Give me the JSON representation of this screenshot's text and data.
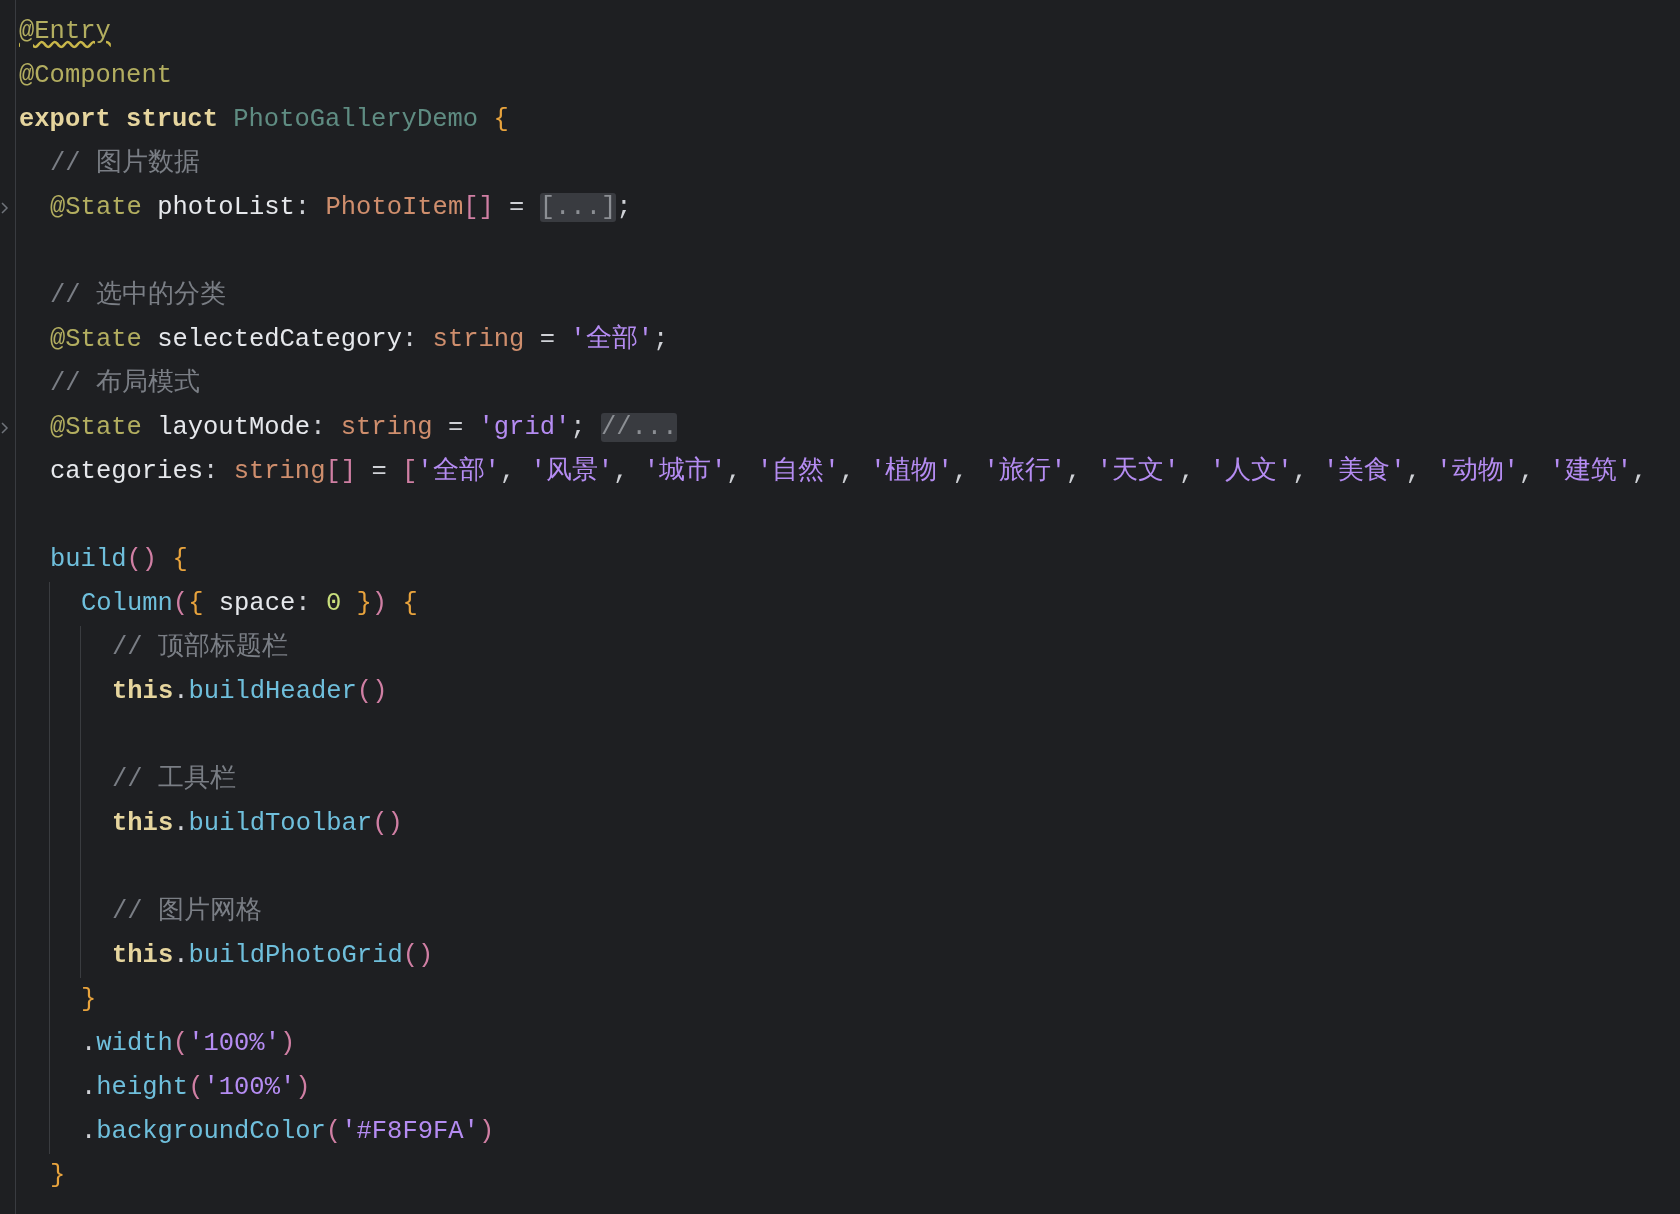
{
  "editor": {
    "lines": [
      {
        "folded": false,
        "tokens": [
          {
            "kind": "annotation-warn",
            "text": "@Entry"
          }
        ]
      },
      {
        "folded": false,
        "tokens": [
          {
            "kind": "annotation",
            "text": "@Component"
          }
        ]
      },
      {
        "folded": false,
        "tokens": [
          {
            "kind": "keyword",
            "text": "export struct "
          },
          {
            "kind": "class",
            "text": "PhotoGalleryDemo "
          },
          {
            "kind": "brace",
            "text": "{"
          }
        ],
        "children": [
          {
            "folded": false,
            "tokens": [
              {
                "kind": "comment",
                "text": "// 图片数据"
              }
            ]
          },
          {
            "folded": true,
            "tokens": [
              {
                "kind": "annotation",
                "text": "@State "
              },
              {
                "kind": "field",
                "text": "photoList"
              },
              {
                "kind": "plain",
                "text": ": "
              },
              {
                "kind": "type",
                "text": "PhotoItem"
              },
              {
                "kind": "paren",
                "text": "[]"
              },
              {
                "kind": "plain",
                "text": " = "
              },
              {
                "kind": "folded",
                "text": "[...]"
              },
              {
                "kind": "plain",
                "text": ";"
              }
            ]
          },
          {
            "folded": false
          },
          {
            "folded": false,
            "tokens": [
              {
                "kind": "comment",
                "text": "// 选中的分类"
              }
            ]
          },
          {
            "folded": false,
            "tokens": [
              {
                "kind": "annotation",
                "text": "@State "
              },
              {
                "kind": "field",
                "text": "selectedCategory"
              },
              {
                "kind": "plain",
                "text": ": "
              },
              {
                "kind": "type",
                "text": "string"
              },
              {
                "kind": "plain",
                "text": " = "
              },
              {
                "kind": "string",
                "text": "'全部'"
              },
              {
                "kind": "plain",
                "text": ";"
              }
            ]
          },
          {
            "folded": false,
            "tokens": [
              {
                "kind": "comment",
                "text": "// 布局模式"
              }
            ]
          },
          {
            "folded": true,
            "tokens": [
              {
                "kind": "annotation",
                "text": "@State "
              },
              {
                "kind": "field",
                "text": "layoutMode"
              },
              {
                "kind": "plain",
                "text": ": "
              },
              {
                "kind": "type",
                "text": "string"
              },
              {
                "kind": "plain",
                "text": " = "
              },
              {
                "kind": "string",
                "text": "'grid'"
              },
              {
                "kind": "plain",
                "text": "; "
              },
              {
                "kind": "folded",
                "text": "//..."
              }
            ]
          },
          {
            "folded": false,
            "tokens": [
              {
                "kind": "field",
                "text": "categories"
              },
              {
                "kind": "plain",
                "text": ": "
              },
              {
                "kind": "type",
                "text": "string"
              },
              {
                "kind": "paren",
                "text": "[]"
              },
              {
                "kind": "plain",
                "text": " = "
              },
              {
                "kind": "paren",
                "text": "["
              },
              {
                "kind": "string",
                "text": "'全部'"
              },
              {
                "kind": "plain",
                "text": ", "
              },
              {
                "kind": "string",
                "text": "'风景'"
              },
              {
                "kind": "plain",
                "text": ", "
              },
              {
                "kind": "string",
                "text": "'城市'"
              },
              {
                "kind": "plain",
                "text": ", "
              },
              {
                "kind": "string",
                "text": "'自然'"
              },
              {
                "kind": "plain",
                "text": ", "
              },
              {
                "kind": "string",
                "text": "'植物'"
              },
              {
                "kind": "plain",
                "text": ", "
              },
              {
                "kind": "string",
                "text": "'旅行'"
              },
              {
                "kind": "plain",
                "text": ", "
              },
              {
                "kind": "string",
                "text": "'天文'"
              },
              {
                "kind": "plain",
                "text": ", "
              },
              {
                "kind": "string",
                "text": "'人文'"
              },
              {
                "kind": "plain",
                "text": ", "
              },
              {
                "kind": "string",
                "text": "'美食'"
              },
              {
                "kind": "plain",
                "text": ", "
              },
              {
                "kind": "string",
                "text": "'动物'"
              },
              {
                "kind": "plain",
                "text": ", "
              },
              {
                "kind": "string",
                "text": "'建筑'"
              },
              {
                "kind": "plain",
                "text": ","
              }
            ]
          },
          {
            "folded": false
          },
          {
            "folded": false,
            "tokens": [
              {
                "kind": "function",
                "text": "build"
              },
              {
                "kind": "paren",
                "text": "()"
              },
              {
                "kind": "brace",
                "text": " {"
              }
            ],
            "children": [
              {
                "folded": false,
                "tokens": [
                  {
                    "kind": "function",
                    "text": "Column"
                  },
                  {
                    "kind": "paren",
                    "text": "("
                  },
                  {
                    "kind": "brace",
                    "text": "{"
                  },
                  {
                    "kind": "field",
                    "text": " space"
                  },
                  {
                    "kind": "plain",
                    "text": ": "
                  },
                  {
                    "kind": "number",
                    "text": "0"
                  },
                  {
                    "kind": "brace",
                    "text": " }"
                  },
                  {
                    "kind": "paren",
                    "text": ")"
                  },
                  {
                    "kind": "brace",
                    "text": " {"
                  }
                ],
                "children": [
                  {
                    "folded": false,
                    "tokens": [
                      {
                        "kind": "comment",
                        "text": "// 顶部标题栏"
                      }
                    ]
                  },
                  {
                    "folded": false,
                    "tokens": [
                      {
                        "kind": "keyword",
                        "text": "this"
                      },
                      {
                        "kind": "plain",
                        "text": "."
                      },
                      {
                        "kind": "function",
                        "text": "buildHeader"
                      },
                      {
                        "kind": "paren",
                        "text": "()"
                      }
                    ]
                  },
                  {
                    "folded": false
                  },
                  {
                    "folded": false,
                    "tokens": [
                      {
                        "kind": "comment",
                        "text": "// 工具栏"
                      }
                    ]
                  },
                  {
                    "folded": false,
                    "tokens": [
                      {
                        "kind": "keyword",
                        "text": "this"
                      },
                      {
                        "kind": "plain",
                        "text": "."
                      },
                      {
                        "kind": "function",
                        "text": "buildToolbar"
                      },
                      {
                        "kind": "paren",
                        "text": "()"
                      }
                    ]
                  },
                  {
                    "folded": false
                  },
                  {
                    "folded": false,
                    "tokens": [
                      {
                        "kind": "comment",
                        "text": "// 图片网格"
                      }
                    ]
                  },
                  {
                    "folded": false,
                    "tokens": [
                      {
                        "kind": "keyword",
                        "text": "this"
                      },
                      {
                        "kind": "plain",
                        "text": "."
                      },
                      {
                        "kind": "function",
                        "text": "buildPhotoGrid"
                      },
                      {
                        "kind": "paren",
                        "text": "()"
                      }
                    ]
                  }
                ]
              },
              {
                "folded": false,
                "tokens": [
                  {
                    "kind": "brace",
                    "text": "}"
                  }
                ]
              },
              {
                "folded": false,
                "tokens": [
                  {
                    "kind": "plain",
                    "text": "."
                  },
                  {
                    "kind": "function",
                    "text": "width"
                  },
                  {
                    "kind": "paren",
                    "text": "("
                  },
                  {
                    "kind": "string",
                    "text": "'100%'"
                  },
                  {
                    "kind": "paren",
                    "text": ")"
                  }
                ]
              },
              {
                "folded": false,
                "tokens": [
                  {
                    "kind": "plain",
                    "text": "."
                  },
                  {
                    "kind": "function",
                    "text": "height"
                  },
                  {
                    "kind": "paren",
                    "text": "("
                  },
                  {
                    "kind": "string",
                    "text": "'100%'"
                  },
                  {
                    "kind": "paren",
                    "text": ")"
                  }
                ]
              },
              {
                "folded": false,
                "tokens": [
                  {
                    "kind": "plain",
                    "text": "."
                  },
                  {
                    "kind": "function",
                    "text": "backgroundColor"
                  },
                  {
                    "kind": "paren",
                    "text": "("
                  },
                  {
                    "kind": "string",
                    "text": "'#F8F9FA'"
                  },
                  {
                    "kind": "paren",
                    "text": ")"
                  }
                ]
              }
            ]
          },
          {
            "folded": false,
            "tokens": [
              {
                "kind": "brace",
                "text": "}"
              }
            ]
          }
        ]
      }
    ]
  }
}
